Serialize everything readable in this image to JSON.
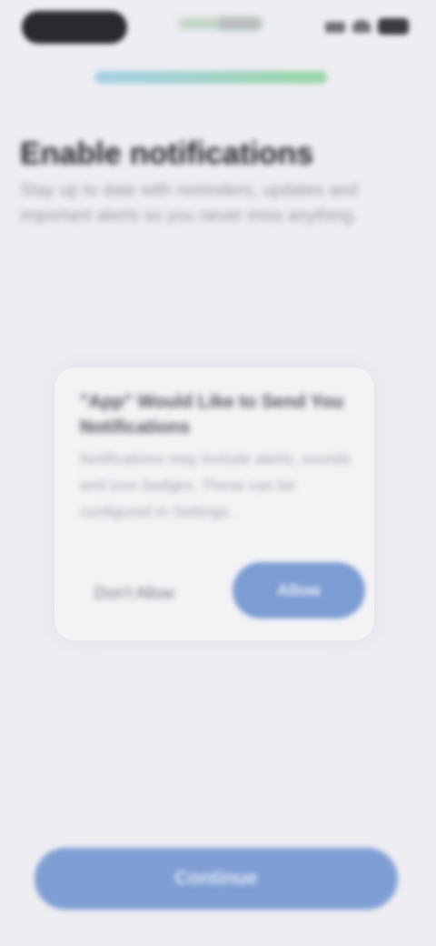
{
  "progress": {
    "value_percent": 100,
    "colors": {
      "start": "#a9cfe7",
      "end": "#9ad6a6"
    }
  },
  "header": {
    "title": "Enable notifications",
    "description": "Stay up to date with reminders, updates and important alerts so you never miss anything."
  },
  "dialog": {
    "title": "\"App\" Would Like to Send You Notifications",
    "body": "Notifications may include alerts, sounds and icon badges. These can be configured in Settings.",
    "secondary_label": "Don't Allow",
    "primary_label": "Allow"
  },
  "cta": {
    "label": "Continue"
  },
  "colors": {
    "background": "#ededf2",
    "accent": "#7c9dd2"
  }
}
